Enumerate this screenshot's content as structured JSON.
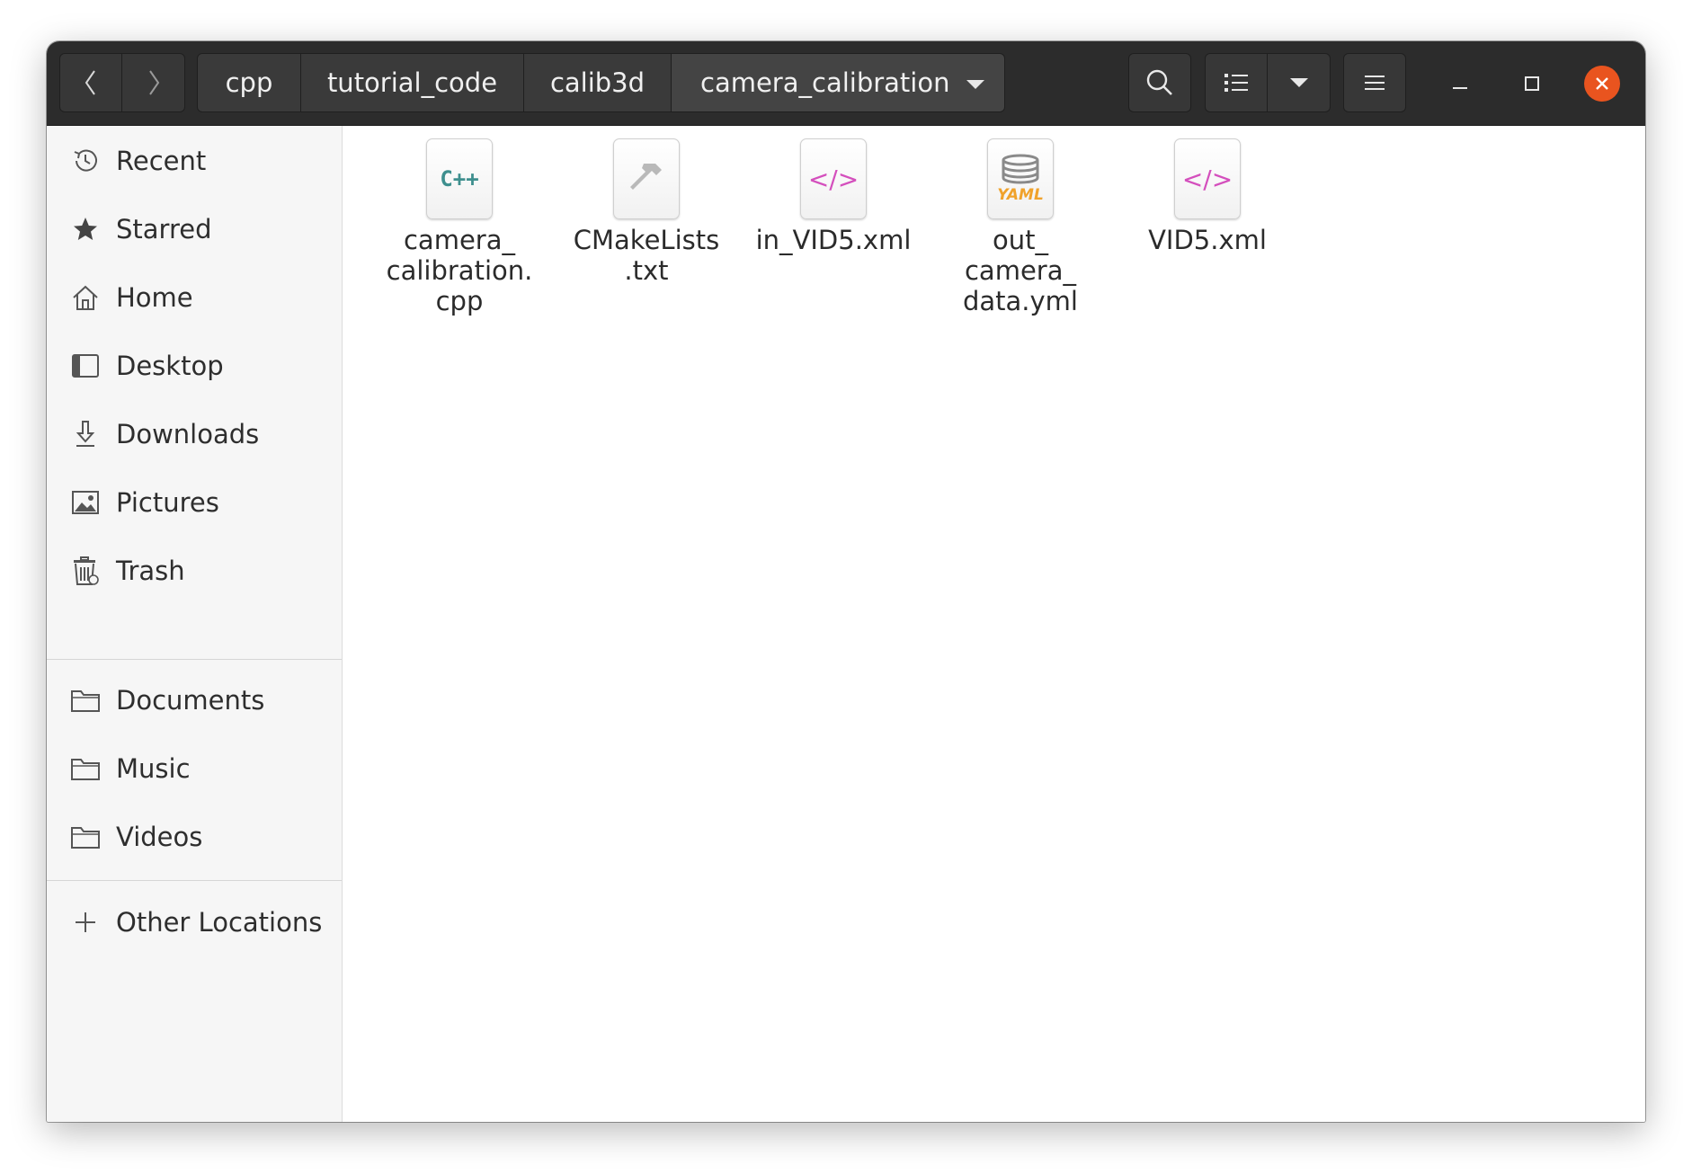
{
  "headerbar": {
    "breadcrumb": [
      "cpp",
      "tutorial_code",
      "calib3d",
      "camera_calibration"
    ]
  },
  "sidebar": {
    "places": [
      {
        "label": "Recent",
        "icon": "clock-icon"
      },
      {
        "label": "Starred",
        "icon": "star-icon"
      },
      {
        "label": "Home",
        "icon": "home-icon"
      },
      {
        "label": "Desktop",
        "icon": "desktop-icon"
      },
      {
        "label": "Downloads",
        "icon": "download-icon"
      },
      {
        "label": "Pictures",
        "icon": "picture-icon"
      },
      {
        "label": "Trash",
        "icon": "trash-icon"
      }
    ],
    "bookmarks": [
      {
        "label": "Documents",
        "icon": "folder-icon"
      },
      {
        "label": "Music",
        "icon": "folder-icon"
      },
      {
        "label": "Videos",
        "icon": "folder-icon"
      }
    ],
    "other": {
      "label": "Other Locations",
      "icon": "plus-icon"
    }
  },
  "files": [
    {
      "name": "camera_\ncalibration.\ncpp",
      "icon": "cpp-file-icon",
      "badge": "C++"
    },
    {
      "name": "CMakeLists\n.txt",
      "icon": "hammer-file-icon"
    },
    {
      "name": "in_VID5.xml",
      "icon": "xml-file-icon",
      "badge": "</>"
    },
    {
      "name": "out_\ncamera_\ndata.yml",
      "icon": "yaml-file-icon",
      "badge": "YAML"
    },
    {
      "name": "VID5.xml",
      "icon": "xml-file-icon",
      "badge": "</>"
    }
  ],
  "colors": {
    "headerbar": "#2c2c2c",
    "close": "#e9541f",
    "cpp": "#3e8f8e",
    "xml": "#d44fbd",
    "yaml": "#f0a22b"
  }
}
